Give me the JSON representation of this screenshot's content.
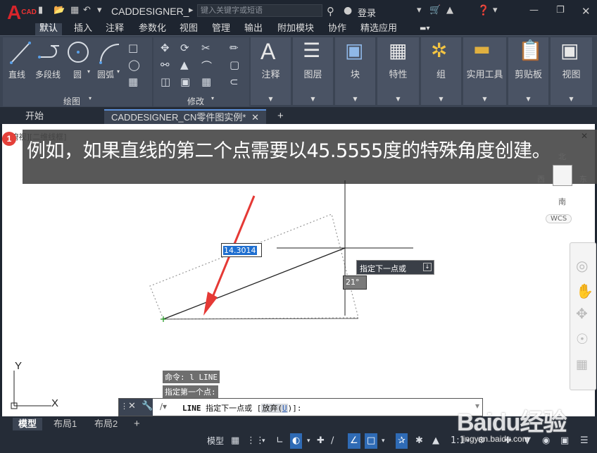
{
  "app": {
    "logo": "A",
    "logo_sub": "CAD",
    "title": "CADDESIGNER_",
    "search_placeholder": "键入关键字或短语",
    "login": "登录"
  },
  "menu": [
    "默认",
    "插入",
    "注释",
    "参数化",
    "视图",
    "管理",
    "输出",
    "附加模块",
    "协作",
    "精选应用"
  ],
  "ribbon": {
    "draw_tools": [
      "直线",
      "多段线",
      "圆",
      "圆弧"
    ],
    "draw_panel": "绘图",
    "modify_panel": "修改",
    "big_buttons": [
      "注释",
      "图层",
      "块",
      "特性",
      "组",
      "实用工具",
      "剪贴板",
      "视图"
    ]
  },
  "doc_tabs": {
    "start": "开始",
    "drawing": "CADDESIGNER_CN零件图实例*"
  },
  "canvas": {
    "viewport_label": "][俯视][二维线框]",
    "banner_step": "1",
    "banner": "例如，如果直线的第二个点需要以45.5555度的特殊角度创建。",
    "dynamic_input": "14.3014",
    "tooltip": "指定下一点或",
    "angle": "21°",
    "compass": {
      "n": "北",
      "s": "南",
      "e": "东",
      "w": "西",
      "ucs": "WCS"
    },
    "axis_y": "Y",
    "axis_x": "X"
  },
  "command": {
    "history": [
      "命令: l LINE",
      "指定第一个点:"
    ],
    "prompt_cmd": "LINE",
    "prompt_text": "指定下一点或 [",
    "option_label": "放弃(",
    "option_key": "U",
    "prompt_end": ")]:"
  },
  "layouts": [
    "模型",
    "布局1",
    "布局2"
  ],
  "status": {
    "model": "模型",
    "scale": "1:1"
  },
  "watermark": {
    "brand": "Baidu经验",
    "url": "jingyan.baidu.com"
  },
  "colors": {
    "accent": "#2f6bb5",
    "banner": "#464646",
    "arrow": "#e53935"
  }
}
